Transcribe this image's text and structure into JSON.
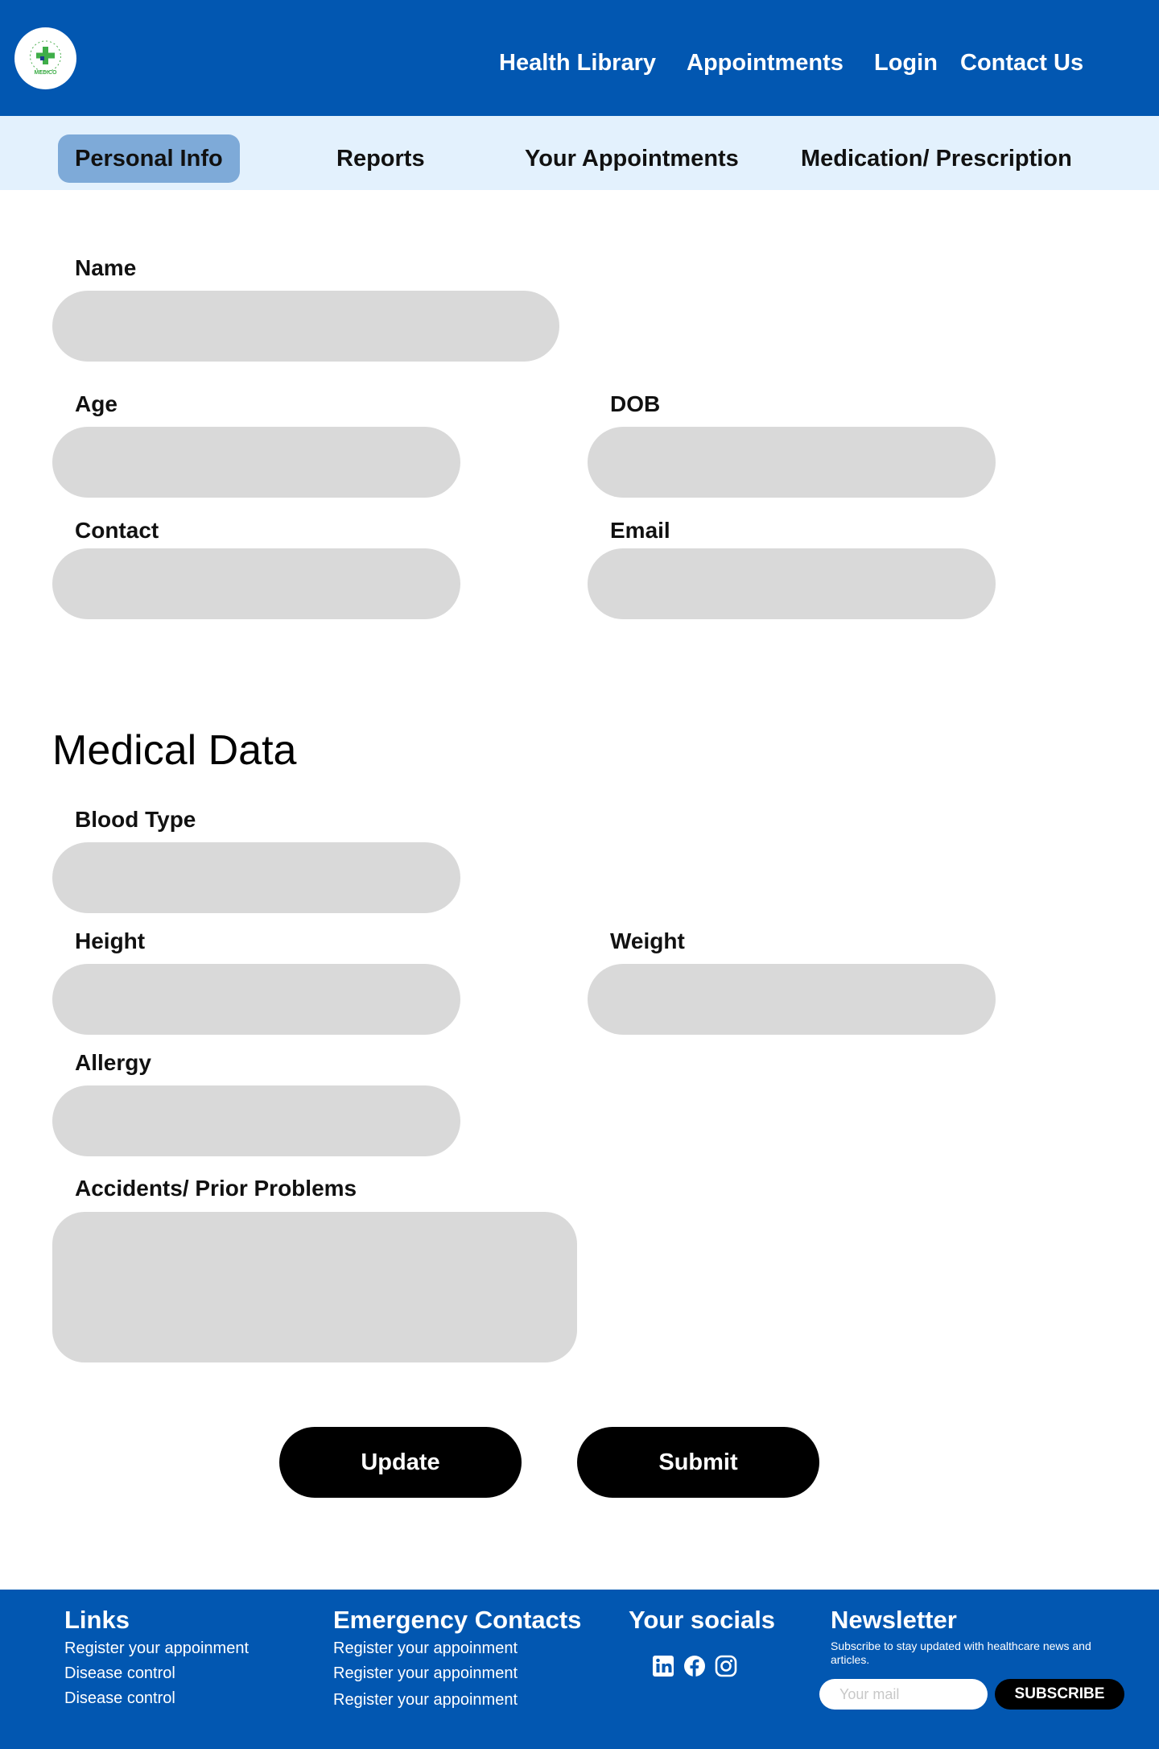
{
  "header": {
    "logo_text": "MEDICO",
    "nav": [
      "Health Library",
      "Appointments",
      "Login",
      "Contact Us"
    ]
  },
  "tabs": {
    "items": [
      "Personal Info",
      "Reports",
      "Your Appointments",
      "Medication/ Prescription"
    ],
    "active": "Personal Info"
  },
  "personal": {
    "name_label": "Name",
    "age_label": "Age",
    "dob_label": "DOB",
    "contact_label": "Contact",
    "email_label": "Email"
  },
  "medical": {
    "title": "Medical Data",
    "blood_label": "Blood Type",
    "height_label": "Height",
    "weight_label": "Weight",
    "allergy_label": "Allergy",
    "accidents_label": "Accidents/ Prior Problems"
  },
  "actions": {
    "update_label": "Update",
    "submit_label": "Submit"
  },
  "footer": {
    "links_title": "Links",
    "links": [
      "Register your appoinment",
      "Disease control",
      "Disease control"
    ],
    "emergency_title": "Emergency Contacts",
    "emergency": [
      "Register your appoinment",
      "Register your appoinment",
      "Register your appoinment"
    ],
    "socials_title": "Your socials",
    "socials": [
      "linkedin-icon",
      "facebook-icon",
      "instagram-icon"
    ],
    "newsletter_title": "Newsletter",
    "newsletter_text": "Subscribe to stay updated with healthcare news and articles.",
    "newsletter_placeholder": "Your mail",
    "subscribe_label": "SUBSCRIBE"
  },
  "colors": {
    "primary": "#0257b1",
    "tab_bar": "#e3f1fd",
    "tab_active": "#7eaad8",
    "field": "#d9d9d9",
    "button": "#000000"
  }
}
